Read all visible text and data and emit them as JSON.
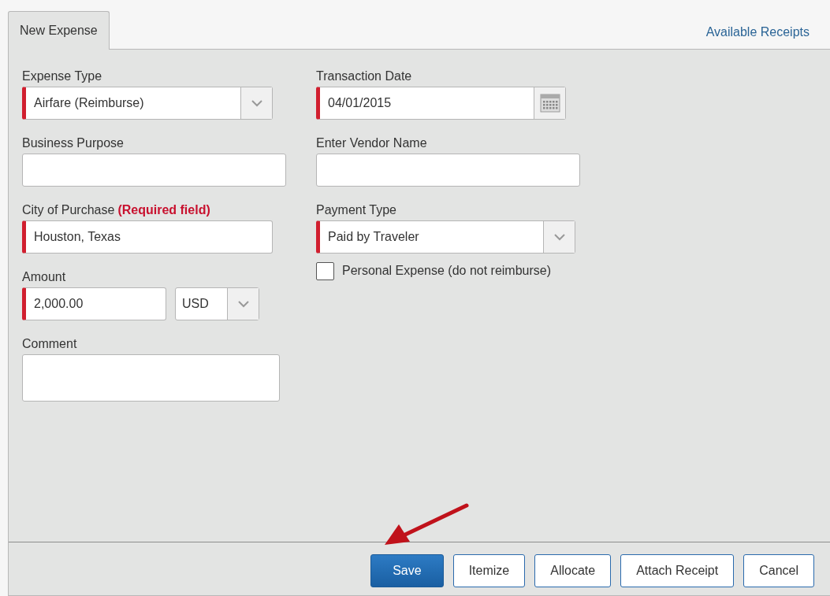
{
  "tabs": [
    {
      "label": "New Expense",
      "selected": true
    }
  ],
  "header_link": "Available Receipts",
  "columns": [
    [
      {
        "kind": "select",
        "label": "Expense Type",
        "value": "Airfare (Reimburse)",
        "required": true
      },
      {
        "kind": "text",
        "label": "Business Purpose",
        "required": false
      },
      {
        "kind": "text",
        "label": "City of Purchase",
        "label_note": "(Required field)",
        "value": "Houston, Texas",
        "required": true
      },
      {
        "kind": "amount",
        "label": "Amount",
        "value": "2,000.00",
        "currency": "USD",
        "required": true
      },
      {
        "kind": "textarea",
        "label": "Comment",
        "required": false
      }
    ],
    [
      {
        "kind": "date",
        "label": "Transaction Date",
        "value": "04/01/2015",
        "required": true
      },
      {
        "kind": "text",
        "label": "Enter Vendor Name",
        "required": false
      },
      {
        "kind": "select",
        "label": "Payment Type",
        "value": "Paid by Traveler",
        "required": true
      },
      {
        "kind": "checkbox",
        "label": "Personal Expense (do not reimburse)",
        "checked": false
      }
    ]
  ],
  "buttons": [
    {
      "label": "Save",
      "primary": true
    },
    {
      "label": "Itemize",
      "primary": false
    },
    {
      "label": "Allocate",
      "primary": false
    },
    {
      "label": "Attach Receipt",
      "primary": false
    },
    {
      "label": "Cancel",
      "primary": false
    }
  ]
}
